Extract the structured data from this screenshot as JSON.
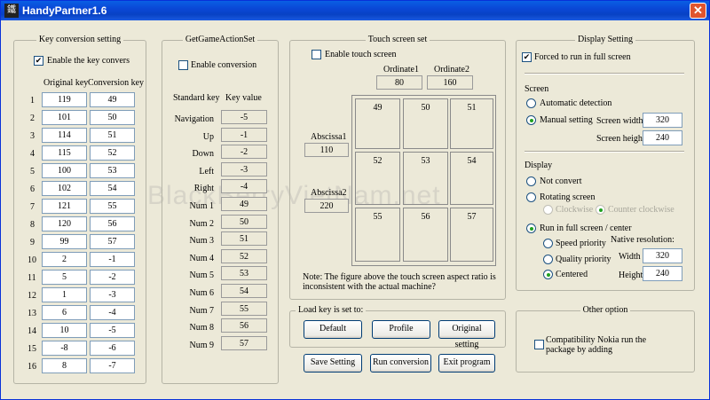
{
  "window": {
    "title": "HandyPartner1.6",
    "icon_glyph": "鐵",
    "close_glyph": "✕"
  },
  "watermark": "BlackBerryVietNam.net",
  "key_conversion": {
    "title": "Key conversion setting",
    "enable_label": "Enable the key convers",
    "enable_checked": true,
    "col_original": "Original key",
    "col_conversion": "Conversion key",
    "rows": [
      {
        "n": "1",
        "orig": "119",
        "conv": "49"
      },
      {
        "n": "2",
        "orig": "101",
        "conv": "50"
      },
      {
        "n": "3",
        "orig": "114",
        "conv": "51"
      },
      {
        "n": "4",
        "orig": "115",
        "conv": "52"
      },
      {
        "n": "5",
        "orig": "100",
        "conv": "53"
      },
      {
        "n": "6",
        "orig": "102",
        "conv": "54"
      },
      {
        "n": "7",
        "orig": "121",
        "conv": "55"
      },
      {
        "n": "8",
        "orig": "120",
        "conv": "56"
      },
      {
        "n": "9",
        "orig": "99",
        "conv": "57"
      },
      {
        "n": "10",
        "orig": "2",
        "conv": "-1"
      },
      {
        "n": "11",
        "orig": "5",
        "conv": "-2"
      },
      {
        "n": "12",
        "orig": "1",
        "conv": "-3"
      },
      {
        "n": "13",
        "orig": "6",
        "conv": "-4"
      },
      {
        "n": "14",
        "orig": "10",
        "conv": "-5"
      },
      {
        "n": "15",
        "orig": "-8",
        "conv": "-6"
      },
      {
        "n": "16",
        "orig": "8",
        "conv": "-7"
      }
    ]
  },
  "game_action": {
    "title": "GetGameActionSet",
    "enable_label": "Enable conversion",
    "enable_checked": false,
    "col_standard": "Standard key",
    "col_value": "Key value",
    "rows": [
      {
        "key": "Navigation",
        "val": "-5"
      },
      {
        "key": "Up",
        "val": "-1"
      },
      {
        "key": "Down",
        "val": "-2"
      },
      {
        "key": "Left",
        "val": "-3"
      },
      {
        "key": "Right",
        "val": "-4"
      },
      {
        "key": "Num 1",
        "val": "49"
      },
      {
        "key": "Num 2",
        "val": "50"
      },
      {
        "key": "Num 3",
        "val": "51"
      },
      {
        "key": "Num 4",
        "val": "52"
      },
      {
        "key": "Num 5",
        "val": "53"
      },
      {
        "key": "Num 6",
        "val": "54"
      },
      {
        "key": "Num 7",
        "val": "55"
      },
      {
        "key": "Num 8",
        "val": "56"
      },
      {
        "key": "Num 9",
        "val": "57"
      }
    ]
  },
  "touch": {
    "title": "Touch screen set",
    "enable_label": "Enable touch screen",
    "enable_checked": false,
    "ordinate1_label": "Ordinate1",
    "ordinate1": "80",
    "ordinate2_label": "Ordinate2",
    "ordinate2": "160",
    "abscissa1_label": "Abscissa1",
    "abscissa1": "110",
    "abscissa2_label": "Abscissa2",
    "abscissa2": "220",
    "grid": [
      "49",
      "50",
      "51",
      "52",
      "53",
      "54",
      "55",
      "56",
      "57"
    ],
    "note": "Note: The figure above the touch screen aspect ratio is",
    "note2": "inconsistent with the actual machine?"
  },
  "load_key": {
    "title": "Load key is set to:",
    "default_btn": "Default",
    "profile_btn": "Profile",
    "original_btn": "Original setting"
  },
  "actions": {
    "save": "Save Setting",
    "run": "Run conversion",
    "exit": "Exit program"
  },
  "display": {
    "title": "Display Setting",
    "forced_label": "Forced to run in full screen",
    "forced_checked": true,
    "screen_heading": "Screen",
    "auto_label": "Automatic detection",
    "manual_label": "Manual setting",
    "width_label": "Screen width",
    "width": "320",
    "height_label": "Screen height",
    "height": "240",
    "display_heading": "Display",
    "not_convert": "Not convert",
    "rotating": "Rotating screen",
    "clockwise": "Clockwise",
    "counter": "Counter clockwise",
    "run_full": "Run in full screen / center",
    "speed": "Speed priority",
    "quality": "Quality priority",
    "centered": "Centered",
    "native_label": "Native resolution:",
    "native_width_label": "Width",
    "native_width": "320",
    "native_height_label": "Height",
    "native_height": "240"
  },
  "other": {
    "title": "Other option",
    "compat_line1": "Compatibility Nokia run the",
    "compat_line2": "package by adding",
    "compat_checked": false
  }
}
